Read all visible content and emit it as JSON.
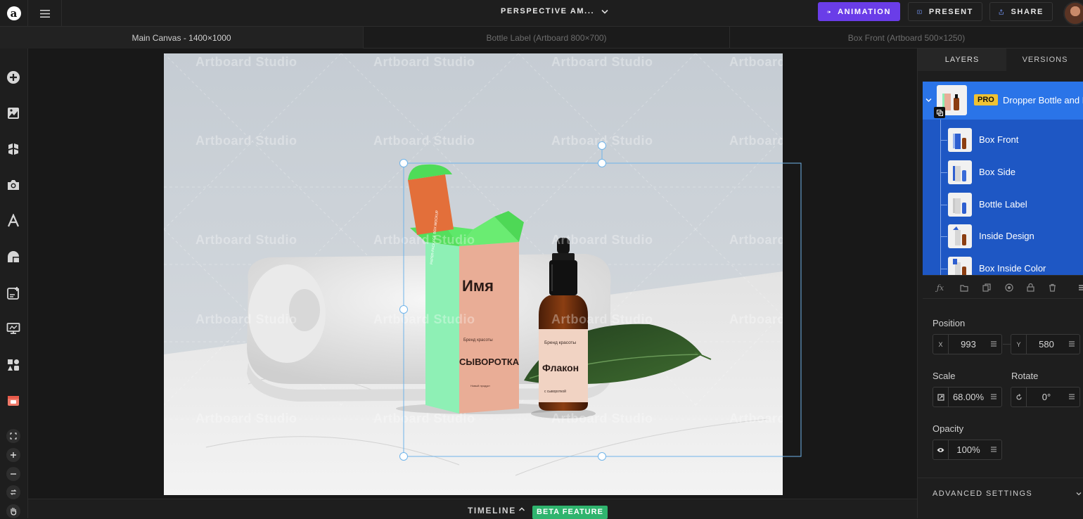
{
  "app": {
    "logo_letter": "a",
    "document_title": "PERSPECTIVE AM...",
    "buttons": {
      "animation": "ANIMATION",
      "present": "PRESENT",
      "share": "SHARE"
    },
    "accent_color": "#6a3de8"
  },
  "tabs": [
    {
      "label": "Main Canvas - 1400×1000",
      "active": true
    },
    {
      "label": "Bottle Label (Artboard 800×700)",
      "active": false
    },
    {
      "label": "Box Front (Artboard 500×1250)",
      "active": false
    }
  ],
  "left_toolbar": [
    "add-icon",
    "image-edit-icon",
    "stamp-icon",
    "camera-icon",
    "text-icon",
    "shape-icon",
    "add-page-icon",
    "screen-icon",
    "elements-icon",
    "mockup-icon"
  ],
  "zoom_controls": [
    "fit-screen-icon",
    "zoom-in-icon",
    "zoom-out-icon",
    "fit-width-icon",
    "hand-icon"
  ],
  "canvas": {
    "watermark": "Artboard Studio",
    "box_front": {
      "title": "Имя",
      "brand": "Бренд красоты",
      "product": "СЫВОРОТКА",
      "bottom_text": "Новый продукт",
      "side_text": "PAPER-PACKAGE BOX MOCKUP"
    },
    "bottle_label": {
      "brand": "Бренд красоты",
      "product": "Флакон",
      "subtitle": "с сывороткой"
    }
  },
  "timeline": {
    "label": "TIMELINE",
    "badge": "BETA FEATURE",
    "badge_color": "#2fb46e"
  },
  "right_panel": {
    "tabs": [
      {
        "label": "LAYERS",
        "active": true
      },
      {
        "label": "VERSIONS",
        "active": false
      }
    ],
    "layer_group": {
      "badge": "PRO",
      "name": "Dropper Bottle and Box"
    },
    "layers": [
      {
        "name": "Box Front"
      },
      {
        "name": "Box Side"
      },
      {
        "name": "Bottle Label"
      },
      {
        "name": "Inside Design"
      },
      {
        "name": "Box Inside Color"
      }
    ],
    "tools": [
      "fx-icon",
      "folder-icon",
      "duplicate-icon",
      "visibility-icon",
      "lock-icon",
      "trash-icon",
      "more-icon"
    ],
    "properties": {
      "position_label": "Position",
      "x_prefix": "X",
      "x_value": "993",
      "y_prefix": "Y",
      "y_value": "580",
      "scale_label": "Scale",
      "scale_value": "68.00%",
      "rotate_label": "Rotate",
      "rotate_value": "0°",
      "opacity_label": "Opacity",
      "opacity_value": "100%"
    },
    "advanced_settings": "ADVANCED SETTINGS"
  }
}
